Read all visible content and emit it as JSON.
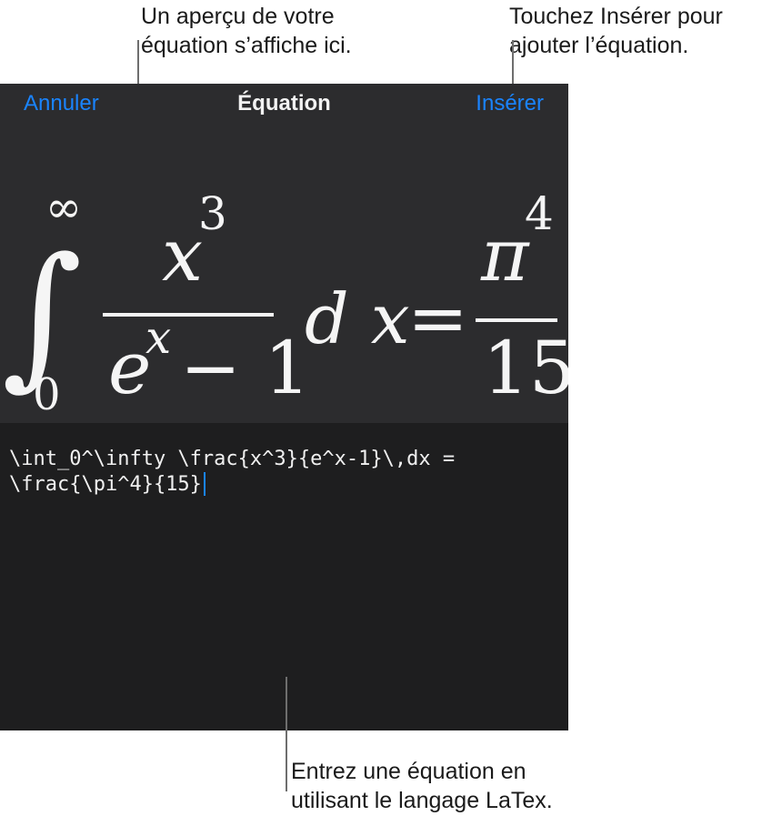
{
  "callouts": {
    "preview": {
      "line1": "Un aperçu de votre",
      "line2": "équation s’affiche ici."
    },
    "insert": {
      "line1": "Touchez Insérer pour",
      "line2": "ajouter l’équation."
    },
    "input": {
      "line1": "Entrez une équation en",
      "line2": "utilisant le langage LaTex."
    }
  },
  "nav": {
    "cancel_label": "Annuler",
    "title": "Équation",
    "insert_label": "Insérer"
  },
  "preview": {
    "integral_sign": "∫",
    "upper_limit": "∞",
    "lower_limit": "0",
    "numerator_base": "x",
    "numerator_exponent": "3",
    "denominator_base": "e",
    "denominator_exponent": "x",
    "denominator_rest": "− 1",
    "differential": "d x",
    "equals": "=",
    "rhs_numerator_base": "π",
    "rhs_numerator_exponent": "4",
    "rhs_denominator": "15"
  },
  "input": {
    "line1": "\\int_0^\\infty \\frac{x^3}{e^x-1}\\,dx =",
    "line2": "\\frac{\\pi^4}{15}"
  },
  "colors": {
    "accent": "#1a84ff",
    "panel_header": "#2c2c2e",
    "panel_body": "#1e1e1f"
  }
}
